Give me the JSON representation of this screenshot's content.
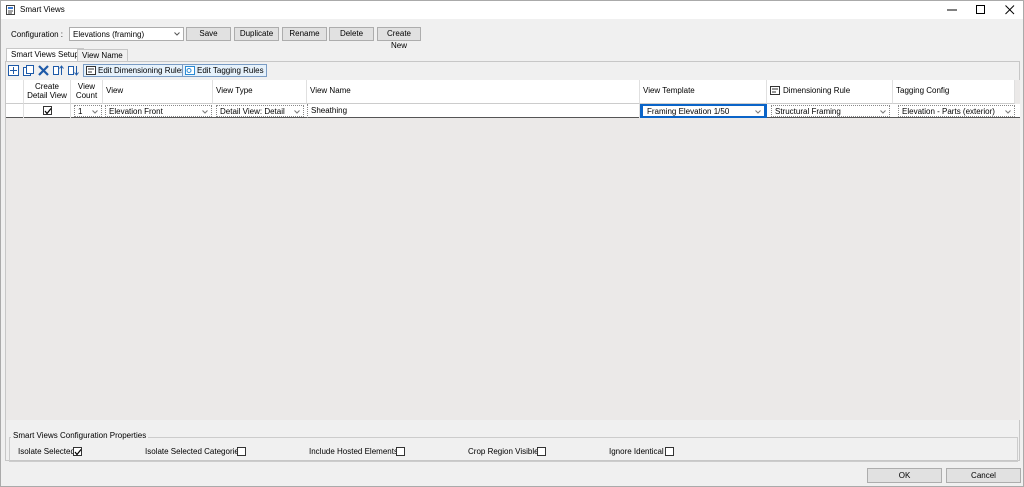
{
  "window": {
    "title": "Smart Views",
    "controls": {
      "minimize": "—",
      "maximize": "☐",
      "close": "✕"
    }
  },
  "toolbar": {
    "configuration_label": "Configuration :",
    "configuration_value": "Elevations (framing)",
    "save_label": "Save",
    "duplicate_label": "Duplicate",
    "rename_label": "Rename",
    "delete_label": "Delete",
    "create_new_label": "Create New"
  },
  "tabs": [
    {
      "label": "Smart Views Setup",
      "active": true
    },
    {
      "label": "View Name",
      "active": false
    }
  ],
  "grid_toolbar": {
    "icons": [
      "add-row-icon",
      "copy-row-icon",
      "delete-row-icon",
      "move-up-icon",
      "move-down-icon"
    ],
    "edit_dimensioning_rules_label": "Edit Dimensioning Rules",
    "edit_tagging_rules_label": "Edit Tagging Rules"
  },
  "grid": {
    "headers": {
      "create_detail_view": "Create Detail View",
      "view_count": "View Count",
      "view": "View",
      "view_type": "View Type",
      "view_name": "View Name",
      "view_template": "View Template",
      "dimensioning_rule": "Dimensioning Rule",
      "tagging_config": "Tagging Config"
    },
    "rows": [
      {
        "create_detail_view": true,
        "view_count": "1",
        "view": "Elevation Front",
        "view_type": "Detail View: Detail",
        "view_name": "Sheathing",
        "view_template": "Framing Elevation 1/50",
        "dimensioning_rule": "Structural Framing",
        "tagging_config": "Elevation - Parts (exterior)"
      }
    ]
  },
  "properties": {
    "group_title": "Smart Views Configuration Properties",
    "isolate_selected": {
      "label": "Isolate Selected",
      "checked": true
    },
    "isolate_selected_categories": {
      "label": "Isolate Selected Categories",
      "checked": false
    },
    "include_hosted_elements": {
      "label": "Include Hosted Elements",
      "checked": false
    },
    "crop_region_visible": {
      "label": "Crop Region Visible",
      "checked": false
    },
    "ignore_identical": {
      "label": "Ignore Identical",
      "checked": false
    }
  },
  "footer": {
    "ok_label": "OK",
    "cancel_label": "Cancel"
  },
  "colors": {
    "accent": "#0a64c8",
    "button_face": "#e1e1e1",
    "window_bg": "#f0f0f0",
    "grid_bg": "#ebe9e8"
  }
}
